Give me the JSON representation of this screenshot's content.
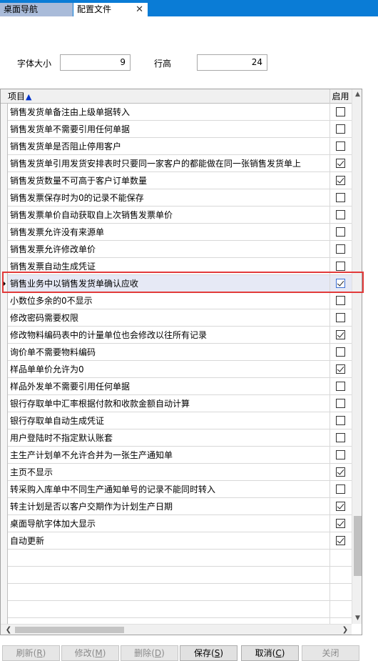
{
  "tabs": [
    {
      "label": "桌面导航",
      "active": false
    },
    {
      "label": "配置文件",
      "active": true
    }
  ],
  "settings": {
    "font_size_label": "字体大小",
    "font_size_value": "9",
    "row_height_label": "行高",
    "row_height_value": "24"
  },
  "grid": {
    "col_item": "项目",
    "col_enabled": "启用",
    "sort_indicator": "▲",
    "rows": [
      {
        "label": "销售发货单备注由上级单据转入",
        "checked": false
      },
      {
        "label": "销售发货单不需要引用任何单据",
        "checked": false
      },
      {
        "label": "销售发货单是否阻止停用客户",
        "checked": false
      },
      {
        "label": "销售发货单引用发货安排表时只要同一家客户的都能做在同一张销售发货单上",
        "checked": true
      },
      {
        "label": "销售发货数量不可高于客户订单数量",
        "checked": true
      },
      {
        "label": "销售发票保存时为0的记录不能保存",
        "checked": false
      },
      {
        "label": "销售发票单价自动获取自上次销售发票单价",
        "checked": false
      },
      {
        "label": "销售发票允许没有来源单",
        "checked": false
      },
      {
        "label": "销售发票允许修改单价",
        "checked": false
      },
      {
        "label": "销售发票自动生成凭证",
        "checked": false
      },
      {
        "label": "销售业务中以销售发货单确认应收",
        "checked": true,
        "selected": true
      },
      {
        "label": "小数位多余的0不显示",
        "checked": false
      },
      {
        "label": "修改密码需要权限",
        "checked": false
      },
      {
        "label": "修改物料编码表中的计量单位也会修改以往所有记录",
        "checked": true
      },
      {
        "label": "询价单不需要物料编码",
        "checked": false
      },
      {
        "label": "样品单单价允许为0",
        "checked": true
      },
      {
        "label": "样品外发单不需要引用任何单据",
        "checked": false
      },
      {
        "label": "银行存取单中汇率根据付款和收款金额自动计算",
        "checked": false
      },
      {
        "label": "银行存取单自动生成凭证",
        "checked": false
      },
      {
        "label": "用户登陆时不指定默认账套",
        "checked": false
      },
      {
        "label": "主生产计划单不允许合并为一张生产通知单",
        "checked": false
      },
      {
        "label": "主页不显示",
        "checked": true
      },
      {
        "label": "转采购入库单中不同生产通知单号的记录不能同时转入",
        "checked": false
      },
      {
        "label": "转主计划是否以客户交期作为计划生产日期",
        "checked": true
      },
      {
        "label": "桌面导航字体加大显示",
        "checked": true
      },
      {
        "label": "自动更新",
        "checked": true
      },
      {
        "label": "",
        "checked": null
      },
      {
        "label": "",
        "checked": null
      },
      {
        "label": "",
        "checked": null
      },
      {
        "label": "",
        "checked": null
      },
      {
        "label": "",
        "checked": null
      }
    ]
  },
  "buttons": [
    {
      "label": "刷新",
      "key": "R",
      "enabled": false
    },
    {
      "label": "修改",
      "key": "M",
      "enabled": false
    },
    {
      "label": "删除",
      "key": "D",
      "enabled": false
    },
    {
      "label": "保存",
      "key": "S",
      "enabled": true
    },
    {
      "label": "取消",
      "key": "C",
      "enabled": true
    },
    {
      "label": "关闭",
      "key": "",
      "enabled": false
    }
  ],
  "colors": {
    "tabbar": "#0a7cd6",
    "highlight_border": "#e23a3a",
    "sort_arrow": "#0033cc"
  }
}
